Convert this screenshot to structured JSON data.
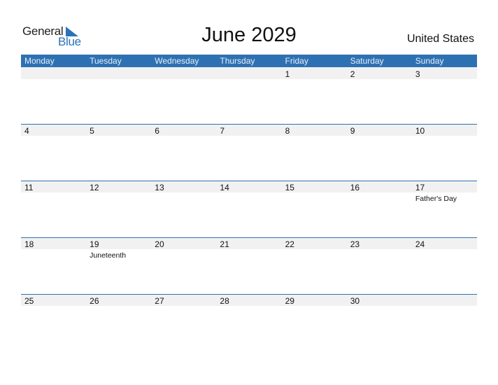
{
  "logo": {
    "word1": "General",
    "word2": "Blue",
    "icon": "triangle-flag-icon",
    "brand_color": "#2a73b8"
  },
  "title": "June 2029",
  "country": "United States",
  "header_color": "#2e71b3",
  "weekdays": [
    "Monday",
    "Tuesday",
    "Wednesday",
    "Thursday",
    "Friday",
    "Saturday",
    "Sunday"
  ],
  "weeks": [
    {
      "days": [
        {
          "num": "",
          "holiday": ""
        },
        {
          "num": "",
          "holiday": ""
        },
        {
          "num": "",
          "holiday": ""
        },
        {
          "num": "",
          "holiday": ""
        },
        {
          "num": "1",
          "holiday": ""
        },
        {
          "num": "2",
          "holiday": ""
        },
        {
          "num": "3",
          "holiday": ""
        }
      ]
    },
    {
      "days": [
        {
          "num": "4",
          "holiday": ""
        },
        {
          "num": "5",
          "holiday": ""
        },
        {
          "num": "6",
          "holiday": ""
        },
        {
          "num": "7",
          "holiday": ""
        },
        {
          "num": "8",
          "holiday": ""
        },
        {
          "num": "9",
          "holiday": ""
        },
        {
          "num": "10",
          "holiday": ""
        }
      ]
    },
    {
      "days": [
        {
          "num": "11",
          "holiday": ""
        },
        {
          "num": "12",
          "holiday": ""
        },
        {
          "num": "13",
          "holiday": ""
        },
        {
          "num": "14",
          "holiday": ""
        },
        {
          "num": "15",
          "holiday": ""
        },
        {
          "num": "16",
          "holiday": ""
        },
        {
          "num": "17",
          "holiday": "Father's Day"
        }
      ]
    },
    {
      "days": [
        {
          "num": "18",
          "holiday": ""
        },
        {
          "num": "19",
          "holiday": "Juneteenth"
        },
        {
          "num": "20",
          "holiday": ""
        },
        {
          "num": "21",
          "holiday": ""
        },
        {
          "num": "22",
          "holiday": ""
        },
        {
          "num": "23",
          "holiday": ""
        },
        {
          "num": "24",
          "holiday": ""
        }
      ]
    },
    {
      "days": [
        {
          "num": "25",
          "holiday": ""
        },
        {
          "num": "26",
          "holiday": ""
        },
        {
          "num": "27",
          "holiday": ""
        },
        {
          "num": "28",
          "holiday": ""
        },
        {
          "num": "29",
          "holiday": ""
        },
        {
          "num": "30",
          "holiday": ""
        },
        {
          "num": "",
          "holiday": ""
        }
      ]
    }
  ]
}
